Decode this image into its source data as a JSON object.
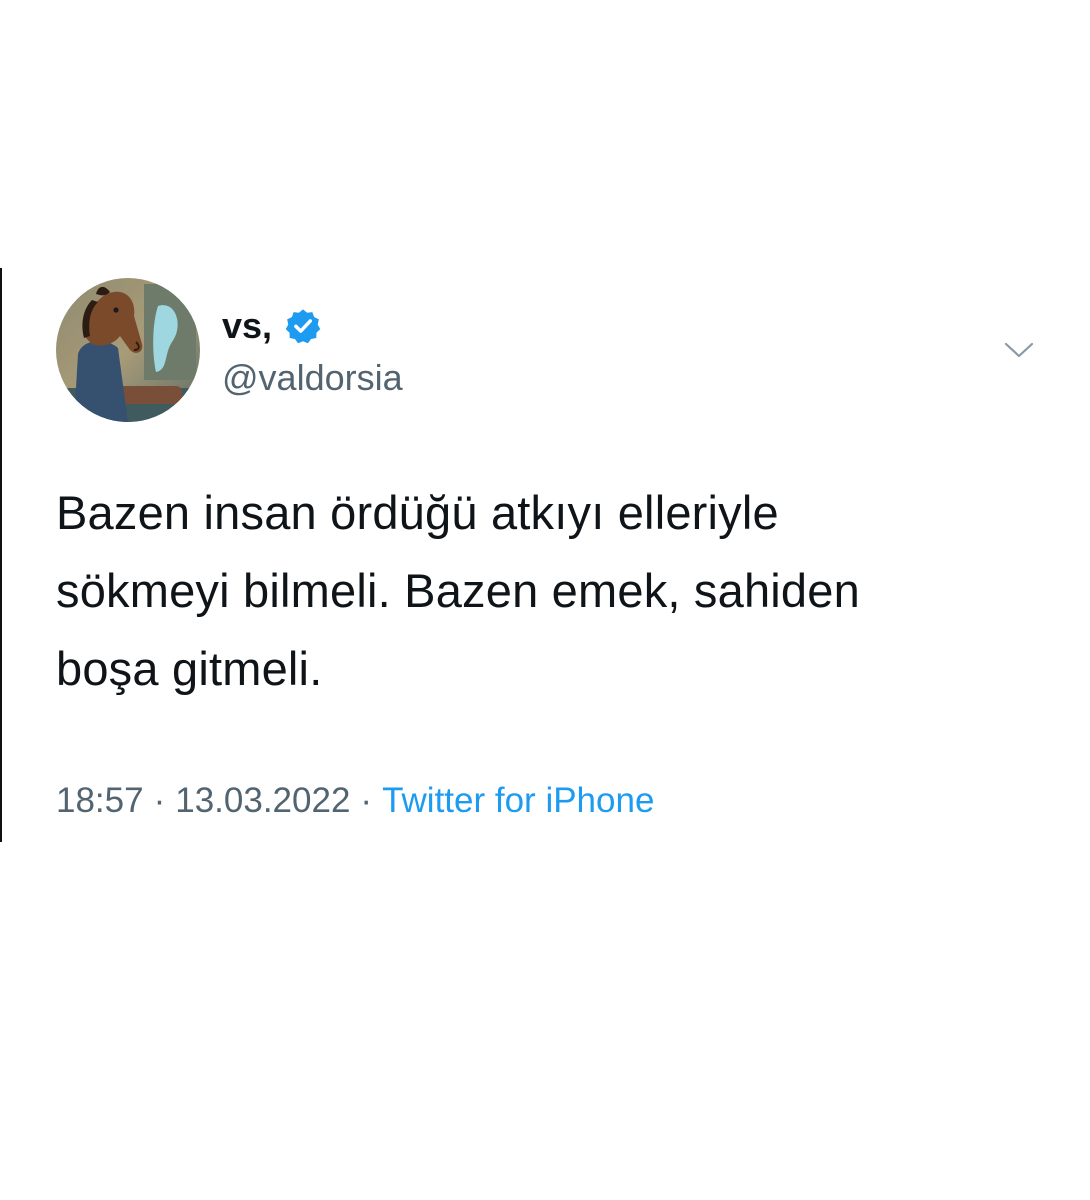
{
  "tweet": {
    "author": {
      "display_name": "vs,",
      "handle": "@valdorsia",
      "verified": true,
      "avatar_icon": "cartoon-horse-avatar"
    },
    "text_lines": [
      "Bazen insan ördüğü atkıyı elleriyle",
      "sökmeyi bilmeli. Bazen emek, sahiden",
      "boşa gitmeli."
    ],
    "time": "18:57",
    "separator": "·",
    "date": "13.03.2022",
    "source": "Twitter for iPhone",
    "menu_icon": "chevron-down-icon"
  },
  "colors": {
    "text_primary": "#0f1419",
    "text_secondary": "#536471",
    "accent": "#1d9bf0",
    "background": "#ffffff"
  }
}
